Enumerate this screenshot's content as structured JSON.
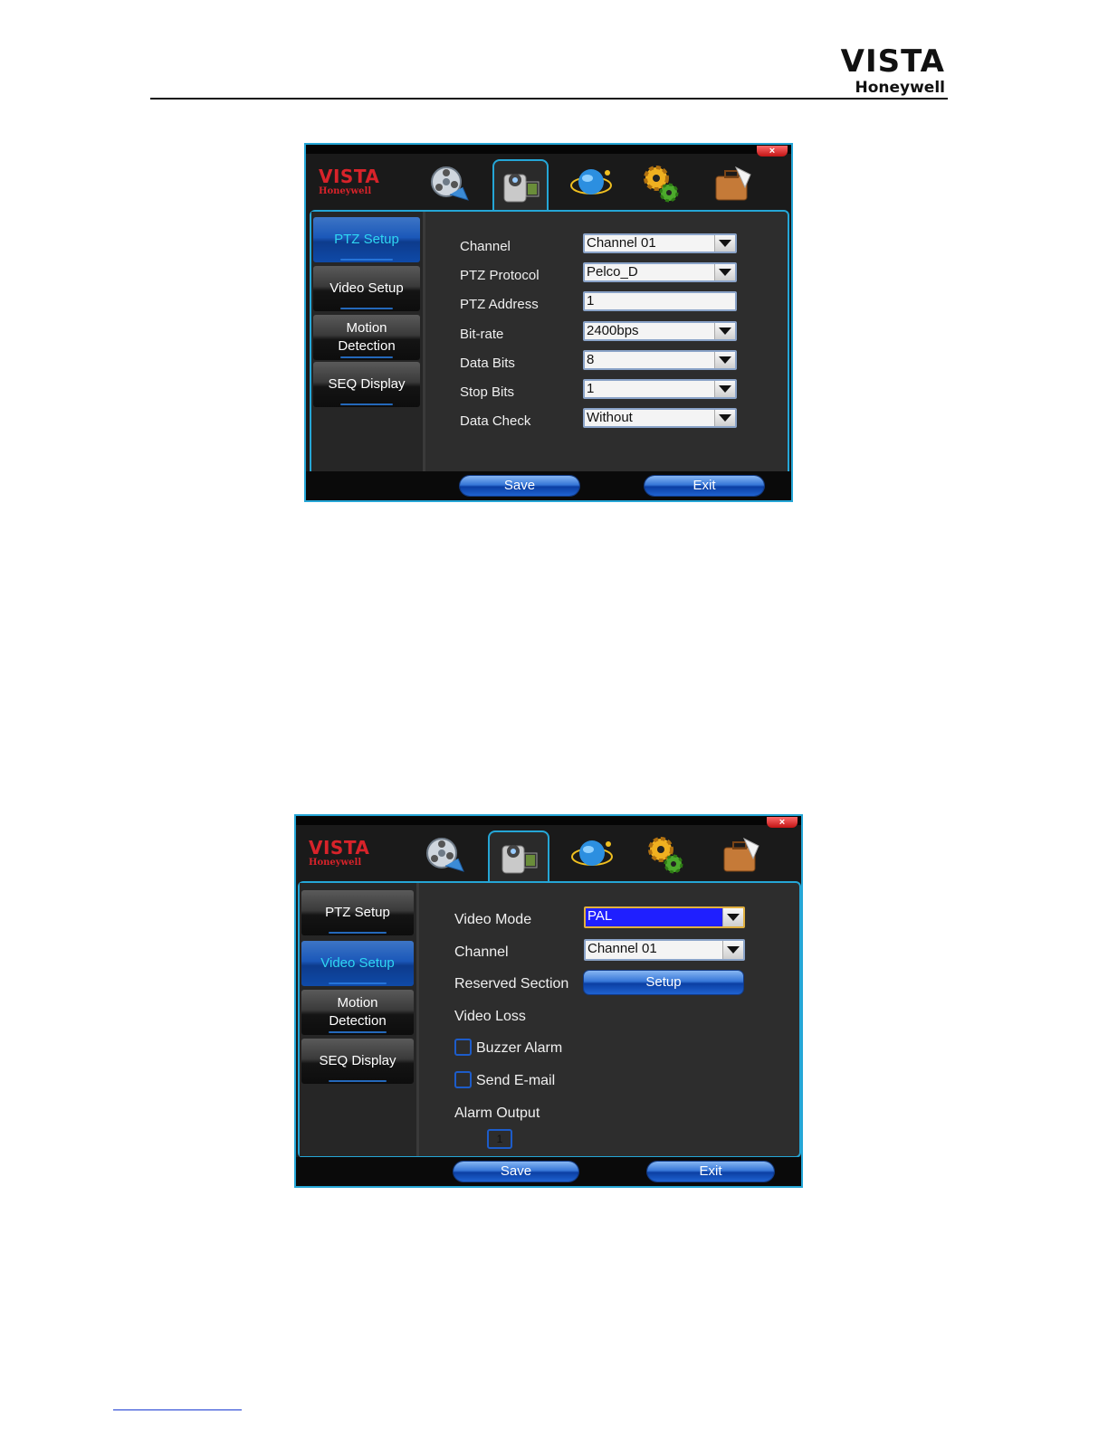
{
  "header": {
    "brand": "VISTA",
    "company": "Honeywell"
  },
  "window_logo": {
    "brand": "VISTA",
    "company": "Honeywell"
  },
  "window_close": "×",
  "icons": [
    "film-reel-icon",
    "camera-icon",
    "globe-network-icon",
    "gears-icon",
    "briefcase-icon"
  ],
  "sidebar": [
    "PTZ Setup",
    "Video Setup",
    "Motion Detection",
    "SEQ Display"
  ],
  "screen1": {
    "active_sidebar": "PTZ Setup",
    "fields": [
      {
        "label": "Channel",
        "value": "Channel 01",
        "type": "select"
      },
      {
        "label": "PTZ Protocol",
        "value": "Pelco_D",
        "type": "select"
      },
      {
        "label": "PTZ Address",
        "value": "1",
        "type": "text"
      },
      {
        "label": "Bit-rate",
        "value": "2400bps",
        "type": "select"
      },
      {
        "label": "Data Bits",
        "value": "8",
        "type": "select"
      },
      {
        "label": "Stop Bits",
        "value": "1",
        "type": "select"
      },
      {
        "label": "Data Check",
        "value": "Without",
        "type": "select"
      }
    ],
    "save": "Save",
    "exit": "Exit"
  },
  "screen2": {
    "active_sidebar": "Video Setup",
    "video_mode_label": "Video Mode",
    "video_mode_value": "PAL",
    "channel_label": "Channel",
    "channel_value": "Channel 01",
    "reserved_label": "Reserved Section",
    "setup_button": "Setup",
    "video_loss_label": "Video Loss",
    "buzzer_label": "Buzzer Alarm",
    "email_label": "Send E-mail",
    "alarm_output_label": "Alarm Output",
    "alarm_output_channel": "1",
    "save": "Save",
    "exit": "Exit"
  },
  "colors": {
    "accent": "#25a6d6",
    "active_text": "#2fd6f2",
    "logo_red": "#d8232a",
    "highlight": "#1f1fff"
  }
}
